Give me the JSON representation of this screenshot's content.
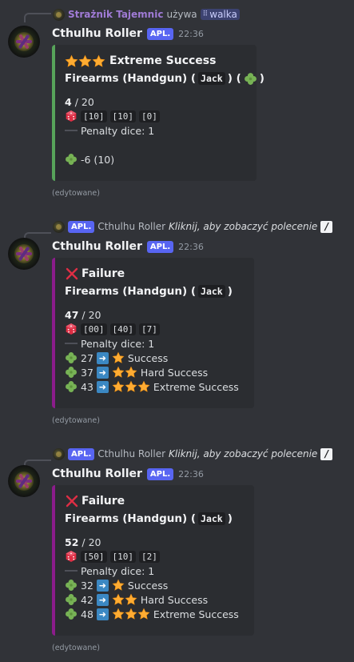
{
  "colors": {
    "background": "#313338",
    "embed_bg": "#2b2d31",
    "success_bar": "#57a35a",
    "failure_bar": "#8b1c8b",
    "tag_bg": "#5865f2",
    "reply_user": "#a07bd6"
  },
  "messages": [
    {
      "reply": {
        "user": "Strażnik Tajemnic",
        "action": "używa",
        "command": "walka",
        "command_icon": "slash-command-icon"
      },
      "author": "Cthulhu Roller",
      "tag": "APL.",
      "time": "22:36",
      "embed": {
        "title": "Extreme Success",
        "title_icon": "three-stars-icon",
        "subtitle_skill": "Firearms (Handgun) (",
        "subtitle_char": "Jack",
        "subtitle_close": ") (",
        "subtitle_end": ")",
        "roll": "4",
        "target": "/ 20",
        "dice": [
          "[10]",
          "[10]",
          "[0]"
        ],
        "penalty": "Penalty dice: 1",
        "luck": "-6 (10)"
      },
      "edited": "(edytowane)"
    },
    {
      "reply": {
        "tag": "APL.",
        "user": "Cthulhu Roller",
        "action": "Kliknij, aby zobaczyć polecenie"
      },
      "author": "Cthulhu Roller",
      "tag": "APL.",
      "time": "22:36",
      "embed": {
        "title": "Failure",
        "title_icon": "red-x-icon",
        "subtitle_skill": "Firearms (Handgun) (",
        "subtitle_char": "Jack",
        "subtitle_close": ")",
        "roll": "47",
        "target": "/ 20",
        "dice": [
          "[00]",
          "[40]",
          "[7]"
        ],
        "penalty": "Penalty dice: 1",
        "luck_options": [
          {
            "cost": "27",
            "result": "Success",
            "stars": 1
          },
          {
            "cost": "37",
            "result": "Hard Success",
            "stars": 2
          },
          {
            "cost": "43",
            "result": "Extreme Success",
            "stars": 3
          }
        ]
      },
      "edited": "(edytowane)"
    },
    {
      "reply": {
        "tag": "APL.",
        "user": "Cthulhu Roller",
        "action": "Kliknij, aby zobaczyć polecenie"
      },
      "author": "Cthulhu Roller",
      "tag": "APL.",
      "time": "22:36",
      "embed": {
        "title": "Failure",
        "title_icon": "red-x-icon",
        "subtitle_skill": "Firearms (Handgun) (",
        "subtitle_char": "Jack",
        "subtitle_close": ")",
        "roll": "52",
        "target": "/ 20",
        "dice": [
          "[50]",
          "[10]",
          "[2]"
        ],
        "penalty": "Penalty dice: 1",
        "luck_options": [
          {
            "cost": "32",
            "result": "Success",
            "stars": 1
          },
          {
            "cost": "42",
            "result": "Hard Success",
            "stars": 2
          },
          {
            "cost": "48",
            "result": "Extreme Success",
            "stars": 3
          }
        ]
      },
      "edited": "(edytowane)"
    }
  ]
}
